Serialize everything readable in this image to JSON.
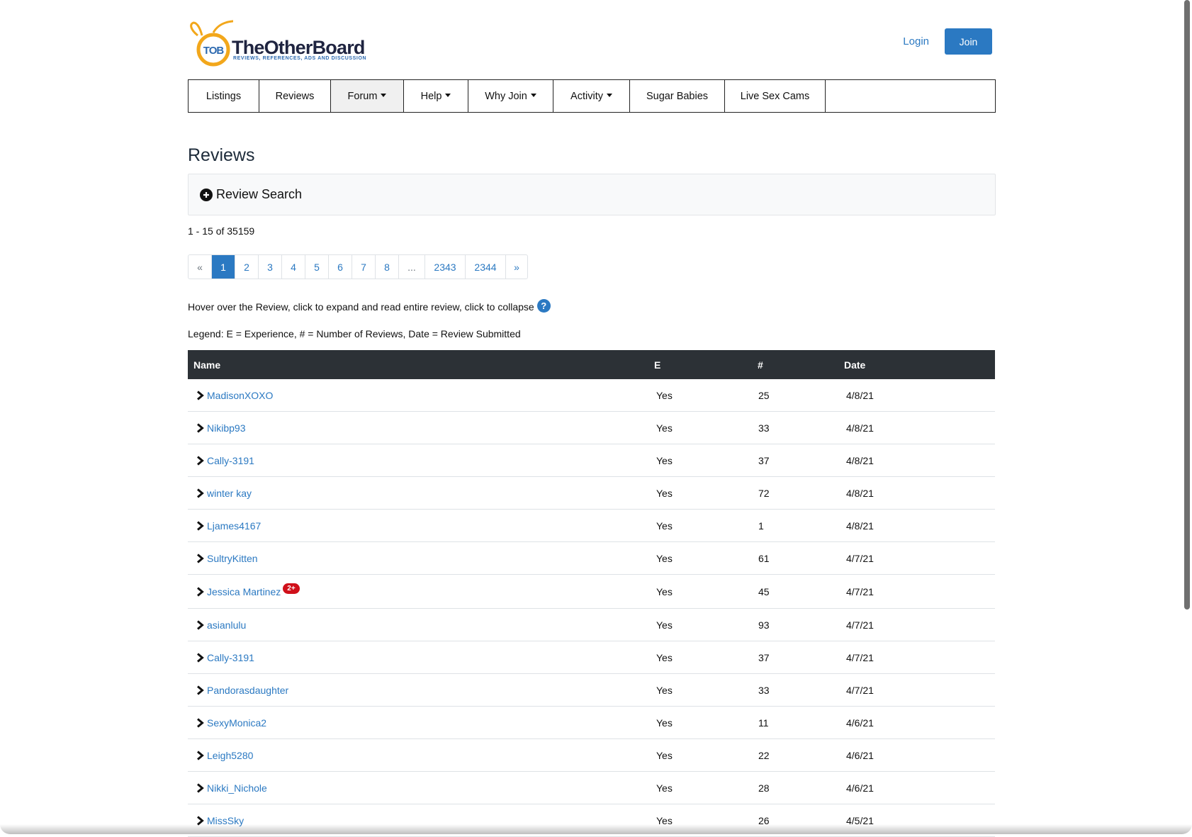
{
  "brand": {
    "logo_text": "TheOtherBoard",
    "logo_badge": "TOB",
    "tagline": "REVIEWS, REFERENCES, ADS AND DISCUSSION",
    "accent_color": "#2b79c2",
    "logo_ring_color": "#f2a71b"
  },
  "auth": {
    "login_label": "Login",
    "join_label": "Join"
  },
  "nav": {
    "items": [
      {
        "label": "Listings",
        "has_caret": false
      },
      {
        "label": "Reviews",
        "has_caret": false
      },
      {
        "label": "Forum",
        "has_caret": true,
        "active": true
      },
      {
        "label": "Help",
        "has_caret": true
      },
      {
        "label": "Why Join",
        "has_caret": true
      },
      {
        "label": "Activity",
        "has_caret": true
      },
      {
        "label": "Sugar Babies",
        "has_caret": false
      },
      {
        "label": "Live Sex Cams",
        "has_caret": false
      }
    ]
  },
  "page": {
    "title": "Reviews",
    "search_label": "Review Search",
    "count_text": "1 - 15 of 35159",
    "hint_text": "Hover over the Review, click to expand and read entire review, click to collapse",
    "help_icon_glyph": "?",
    "legend_text": "Legend: E = Experience, # = Number of Reviews, Date = Review Submitted"
  },
  "pagination": {
    "pages": [
      "«",
      "1",
      "2",
      "3",
      "4",
      "5",
      "6",
      "7",
      "8",
      "...",
      "2343",
      "2344",
      "»"
    ],
    "current": "1"
  },
  "table": {
    "headers": {
      "name": "Name",
      "e": "E",
      "count": "#",
      "date": "Date"
    },
    "rows": [
      {
        "name": "MadisonXOXO",
        "e": "Yes",
        "count": "25",
        "date": "4/8/21"
      },
      {
        "name": "Nikibp93",
        "e": "Yes",
        "count": "33",
        "date": "4/8/21"
      },
      {
        "name": "Cally-3191",
        "e": "Yes",
        "count": "37",
        "date": "4/8/21"
      },
      {
        "name": "winter kay",
        "e": "Yes",
        "count": "72",
        "date": "4/8/21"
      },
      {
        "name": "Ljames4167",
        "e": "Yes",
        "count": "1",
        "date": "4/8/21"
      },
      {
        "name": "SultryKitten",
        "e": "Yes",
        "count": "61",
        "date": "4/7/21"
      },
      {
        "name": "Jessica Martinez",
        "badge": "2+",
        "e": "Yes",
        "count": "45",
        "date": "4/7/21"
      },
      {
        "name": "asianlulu",
        "e": "Yes",
        "count": "93",
        "date": "4/7/21"
      },
      {
        "name": "Cally-3191",
        "e": "Yes",
        "count": "37",
        "date": "4/7/21"
      },
      {
        "name": "Pandorasdaughter",
        "e": "Yes",
        "count": "33",
        "date": "4/7/21"
      },
      {
        "name": "SexyMonica2",
        "e": "Yes",
        "count": "11",
        "date": "4/6/21"
      },
      {
        "name": "Leigh5280",
        "e": "Yes",
        "count": "22",
        "date": "4/6/21"
      },
      {
        "name": "Nikki_Nichole",
        "e": "Yes",
        "count": "28",
        "date": "4/6/21"
      },
      {
        "name": "MissSky",
        "e": "Yes",
        "count": "26",
        "date": "4/5/21"
      }
    ]
  }
}
